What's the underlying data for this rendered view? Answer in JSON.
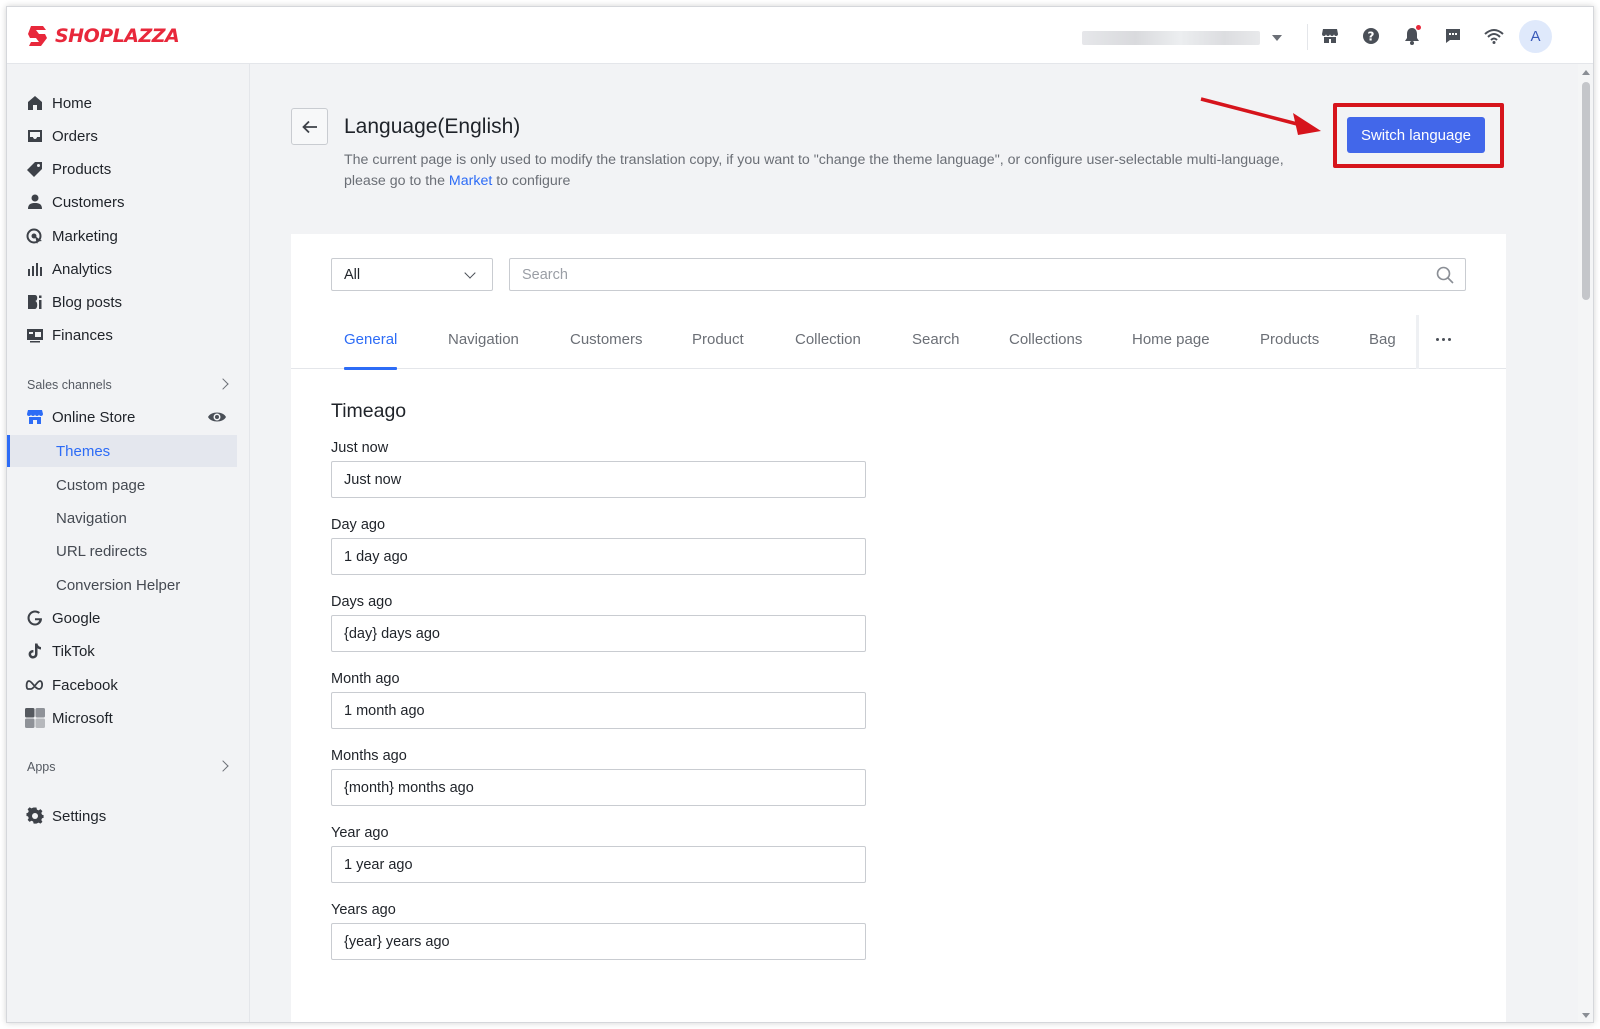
{
  "brand": {
    "name": "SHOPLAZZA",
    "color": "#e8283b"
  },
  "topbar": {
    "icons": [
      "store-icon",
      "help-icon",
      "bell-icon",
      "chat-icon",
      "wifi-icon"
    ],
    "avatar_letter": "A"
  },
  "sidebar": {
    "items": [
      {
        "label": "Home",
        "icon": "home-icon"
      },
      {
        "label": "Orders",
        "icon": "inbox-icon"
      },
      {
        "label": "Products",
        "icon": "tag-icon"
      },
      {
        "label": "Customers",
        "icon": "person-icon"
      },
      {
        "label": "Marketing",
        "icon": "target-icon"
      },
      {
        "label": "Analytics",
        "icon": "bar-chart-icon"
      },
      {
        "label": "Blog posts",
        "icon": "blog-icon"
      },
      {
        "label": "Finances",
        "icon": "finance-icon"
      }
    ],
    "sales_channels_label": "Sales channels",
    "online_store": {
      "label": "Online Store",
      "sub_items": [
        {
          "label": "Themes",
          "active": true
        },
        {
          "label": "Custom page",
          "active": false
        },
        {
          "label": "Navigation",
          "active": false
        },
        {
          "label": "URL redirects",
          "active": false
        },
        {
          "label": "Conversion Helper",
          "active": false
        }
      ]
    },
    "channels": [
      {
        "label": "Google",
        "icon": "google-icon"
      },
      {
        "label": "TikTok",
        "icon": "tiktok-icon"
      },
      {
        "label": "Facebook",
        "icon": "meta-icon"
      },
      {
        "label": "Microsoft",
        "icon": "microsoft-icon"
      }
    ],
    "apps_label": "Apps",
    "settings_label": "Settings"
  },
  "page": {
    "title": "Language(English)",
    "desc_before": "The current page is only used to modify the translation copy, if you want to \"change the theme language\", or configure user-selectable multi-language, please go to the ",
    "desc_link": "Market",
    "desc_after": " to configure",
    "switch_button": "Switch language",
    "accent_color": "#4267ea",
    "highlight_color": "#d6141c"
  },
  "filters": {
    "select_value": "All",
    "search_placeholder": "Search"
  },
  "tabs": [
    {
      "label": "General",
      "active": true
    },
    {
      "label": "Navigation",
      "active": false
    },
    {
      "label": "Customers",
      "active": false
    },
    {
      "label": "Product",
      "active": false
    },
    {
      "label": "Collection",
      "active": false
    },
    {
      "label": "Search",
      "active": false
    },
    {
      "label": "Collections",
      "active": false
    },
    {
      "label": "Home page",
      "active": false
    },
    {
      "label": "Products",
      "active": false
    },
    {
      "label": "Bag",
      "active": false
    }
  ],
  "section": {
    "title": "Timeago",
    "fields": [
      {
        "label": "Just now",
        "value": "Just now"
      },
      {
        "label": "Day ago",
        "value": "1 day ago"
      },
      {
        "label": "Days ago",
        "value": "{day} days ago"
      },
      {
        "label": "Month ago",
        "value": "1 month ago"
      },
      {
        "label": "Months ago",
        "value": "{month} months ago"
      },
      {
        "label": "Year ago",
        "value": "1 year ago"
      },
      {
        "label": "Years ago",
        "value": "{year} years ago"
      }
    ]
  }
}
